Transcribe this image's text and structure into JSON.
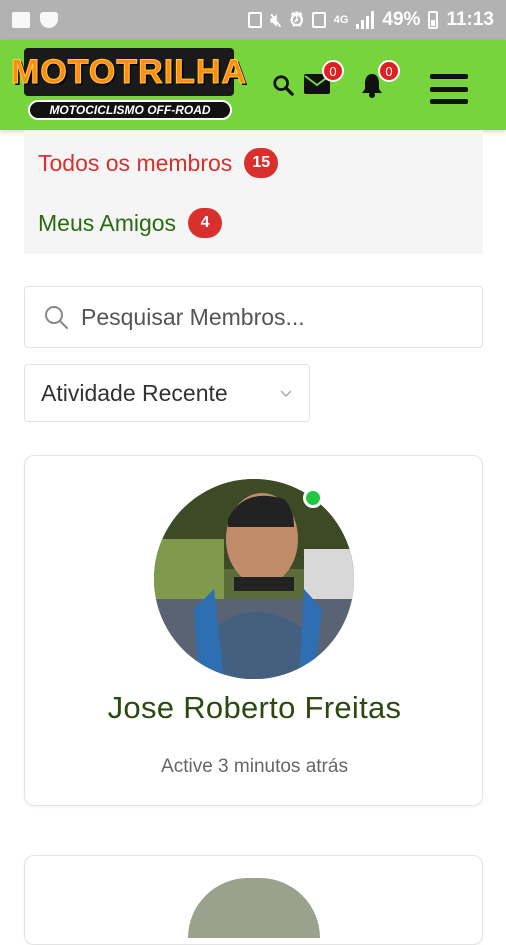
{
  "status_bar": {
    "signal_type": "4G",
    "battery": "49%",
    "time": "11:13",
    "icons": [
      "image-icon",
      "shield-icon",
      "download-icon",
      "mute-icon",
      "alarm-icon",
      "sim-icon",
      "signal-icon",
      "battery-icon"
    ]
  },
  "header": {
    "logo_title": "MOTOTRILHA",
    "logo_subtitle": "MOTOCICLISMO OFF-ROAD",
    "messages_count": "0",
    "notifications_count": "0",
    "accent_color": "#78d43c"
  },
  "tabs": [
    {
      "label": "Todos os membros",
      "count": "15",
      "active": true
    },
    {
      "label": "Meus Amigos",
      "count": "4",
      "active": false
    }
  ],
  "search": {
    "placeholder": "Pesquisar Membros..."
  },
  "order": {
    "selected": "Atividade Recente"
  },
  "members": [
    {
      "name": "Jose Roberto Freitas",
      "activity": "Active 3 minutos atrás",
      "online": true
    }
  ]
}
